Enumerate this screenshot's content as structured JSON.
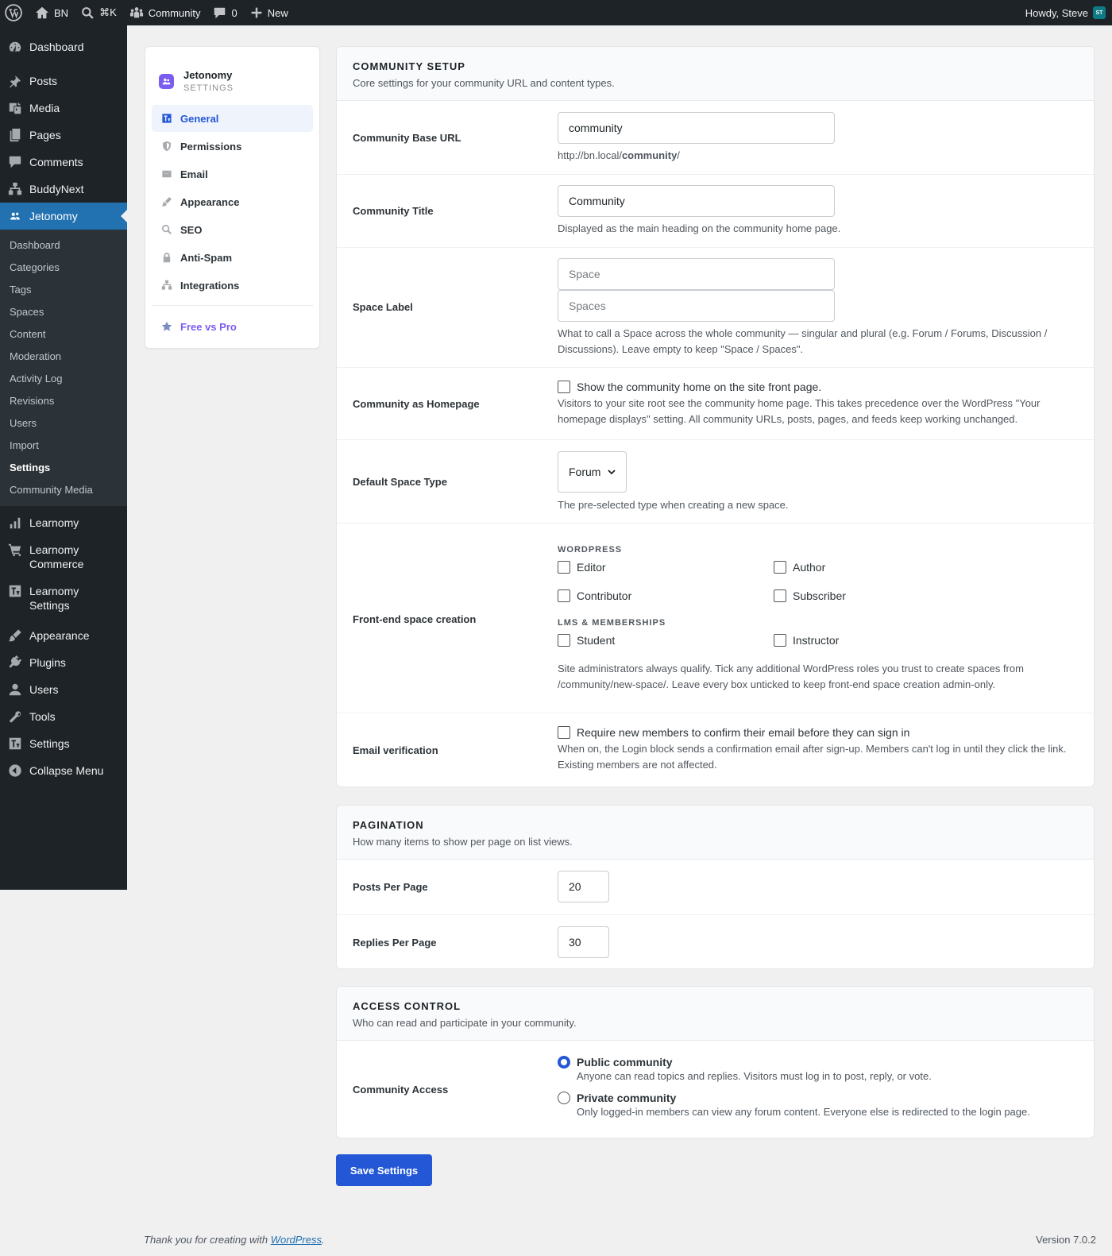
{
  "adminbar": {
    "site": "BN",
    "search_shortcut": "⌘K",
    "community": "Community",
    "comments_count": "0",
    "new": "New",
    "howdy": "Howdy, Steve",
    "avatar_initials": "ST"
  },
  "menu": {
    "dashboard": "Dashboard",
    "posts": "Posts",
    "media": "Media",
    "pages": "Pages",
    "comments": "Comments",
    "buddynext": "BuddyNext",
    "jetonomy": "Jetonomy",
    "submenu": [
      "Dashboard",
      "Categories",
      "Tags",
      "Spaces",
      "Content",
      "Moderation",
      "Activity Log",
      "Revisions",
      "Users",
      "Import",
      "Settings",
      "Community Media"
    ],
    "learnomy": "Learnomy",
    "learnomy_commerce": "Learnomy Commerce",
    "learnomy_settings": "Learnomy Settings",
    "appearance": "Appearance",
    "plugins": "Plugins",
    "users": "Users",
    "tools": "Tools",
    "settings": "Settings",
    "collapse": "Collapse Menu"
  },
  "settings_nav": {
    "brand": "Jetonomy",
    "brand_sub": "SETTINGS",
    "items": [
      "General",
      "Permissions",
      "Email",
      "Appearance",
      "SEO",
      "Anti-Spam",
      "Integrations"
    ],
    "pro": "Free vs Pro"
  },
  "community_setup": {
    "title": "COMMUNITY SETUP",
    "subtitle": "Core settings for your community URL and content types.",
    "base_url": {
      "label": "Community Base URL",
      "value": "community",
      "hint_prefix": "http://bn.local/",
      "hint_slug": "community",
      "hint_suffix": "/"
    },
    "title_field": {
      "label": "Community Title",
      "value": "Community",
      "desc": "Displayed as the main heading on the community home page."
    },
    "space_label": {
      "label": "Space Label",
      "singular_placeholder": "Space",
      "plural_placeholder": "Spaces",
      "desc": "What to call a Space across the whole community — singular and plural (e.g. Forum / Forums, Discussion / Discussions). Leave empty to keep \"Space / Spaces\"."
    },
    "homepage": {
      "label": "Community as Homepage",
      "checkbox": "Show the community home on the site front page.",
      "desc": "Visitors to your site root see the community home page. This takes precedence over the WordPress \"Your homepage displays\" setting. All community URLs, posts, pages, and feeds keep working unchanged."
    },
    "space_type": {
      "label": "Default Space Type",
      "value": "Forum",
      "desc": "The pre-selected type when creating a new space."
    },
    "frontend": {
      "label": "Front-end space creation",
      "group_wp": "WORDPRESS",
      "wp_roles": [
        "Editor",
        "Author",
        "Contributor",
        "Subscriber"
      ],
      "group_lms": "LMS & MEMBERSHIPS",
      "lms_roles": [
        "Student",
        "Instructor"
      ],
      "desc": "Site administrators always qualify. Tick any additional WordPress roles you trust to create spaces from /community/new-space/. Leave every box unticked to keep front-end space creation admin-only."
    },
    "email_verification": {
      "label": "Email verification",
      "checkbox": "Require new members to confirm their email before they can sign in",
      "desc": "When on, the Login block sends a confirmation email after sign-up. Members can't log in until they click the link. Existing members are not affected."
    }
  },
  "pagination": {
    "title": "PAGINATION",
    "subtitle": "How many items to show per page on list views.",
    "posts_label": "Posts Per Page",
    "posts_value": "20",
    "replies_label": "Replies Per Page",
    "replies_value": "30"
  },
  "access": {
    "title": "ACCESS CONTROL",
    "subtitle": "Who can read and participate in your community.",
    "label": "Community Access",
    "public_title": "Public community",
    "public_desc": "Anyone can read topics and replies. Visitors must log in to post, reply, or vote.",
    "private_title": "Private community",
    "private_desc": "Only logged-in members can view any forum content. Everyone else is redirected to the login page."
  },
  "save_label": "Save Settings",
  "footer": {
    "thanks": "Thank you for creating with ",
    "link": "WordPress",
    "period": ".",
    "version": "Version 7.0.2"
  },
  "colors": {
    "accent": "#2457d6",
    "admin_dark": "#1d2327",
    "wp_blue": "#2271b1",
    "brand_purple": "#7b5cf0"
  }
}
